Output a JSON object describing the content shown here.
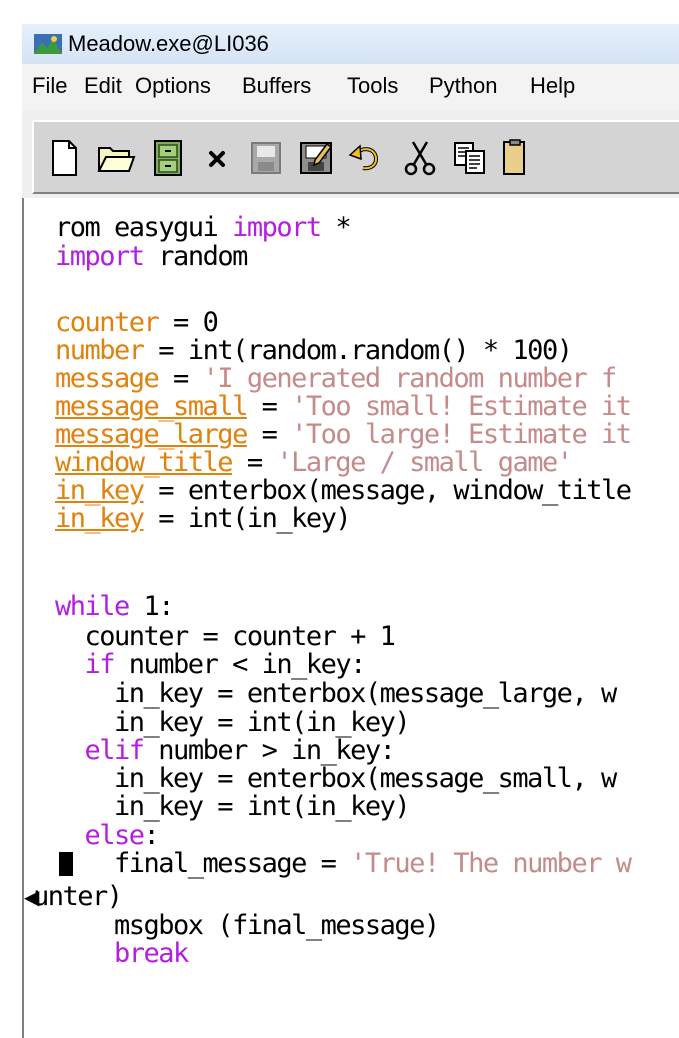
{
  "window": {
    "title": "Meadow.exe@LI036"
  },
  "menu": [
    "File",
    "Edit",
    "Options",
    "Buffers",
    "Tools",
    "Python",
    "Help"
  ],
  "toolbar": {
    "buttons": [
      "new-file",
      "open-folder",
      "dired",
      "close-buffer",
      "save",
      "save-as",
      "undo",
      "cut",
      "copy",
      "paste"
    ]
  },
  "editor": {
    "lines": [
      [
        {
          "t": "rom easygui ",
          "c": ""
        },
        {
          "t": "import",
          "c": "kw"
        },
        {
          "t": " *",
          "c": ""
        }
      ],
      [
        {
          "t": "import",
          "c": "kw"
        },
        {
          "t": " random",
          "c": ""
        }
      ],
      [],
      [
        {
          "t": "counter",
          "c": "var"
        },
        {
          "t": " = 0",
          "c": ""
        }
      ],
      [
        {
          "t": "number",
          "c": "var"
        },
        {
          "t": " = int(random.random() * 100)",
          "c": ""
        }
      ],
      [
        {
          "t": "message",
          "c": "var"
        },
        {
          "t": " = ",
          "c": ""
        },
        {
          "t": "'I generated random number f",
          "c": "str"
        }
      ],
      [
        {
          "t": "message_small",
          "c": "var ul"
        },
        {
          "t": " = ",
          "c": ""
        },
        {
          "t": "'Too small! Estimate it",
          "c": "str"
        }
      ],
      [
        {
          "t": "message_large",
          "c": "var ul"
        },
        {
          "t": " = ",
          "c": ""
        },
        {
          "t": "'Too large! Estimate it",
          "c": "str"
        }
      ],
      [
        {
          "t": "window_title",
          "c": "var ul"
        },
        {
          "t": " = ",
          "c": ""
        },
        {
          "t": "'Large / small game'",
          "c": "str"
        }
      ],
      [
        {
          "t": "in_key",
          "c": "var ul"
        },
        {
          "t": " = enterbox(message, window_title",
          "c": ""
        }
      ],
      [
        {
          "t": "in_key",
          "c": "var ul"
        },
        {
          "t": " = int(in_key)",
          "c": ""
        }
      ],
      [],
      [
        {
          "t": "while",
          "c": "kw"
        },
        {
          "t": " 1:",
          "c": ""
        }
      ],
      [
        {
          "t": "  counter = counter + 1",
          "c": ""
        }
      ],
      [
        {
          "t": "  ",
          "c": ""
        },
        {
          "t": "if",
          "c": "kw"
        },
        {
          "t": " number < in_key:",
          "c": ""
        }
      ],
      [
        {
          "t": "    in_key = enterbox(message_large, w",
          "c": ""
        }
      ],
      [
        {
          "t": "    in_key = int(in_key)",
          "c": ""
        }
      ],
      [
        {
          "t": "  ",
          "c": ""
        },
        {
          "t": "elif",
          "c": "kw"
        },
        {
          "t": " number > in_key:",
          "c": ""
        }
      ],
      [
        {
          "t": "    in_key = enterbox(message_small, w",
          "c": ""
        }
      ],
      [
        {
          "t": "    in_key = int(in_key)",
          "c": ""
        }
      ],
      [
        {
          "t": "  ",
          "c": ""
        },
        {
          "t": "else",
          "c": "kw"
        },
        {
          "t": ":",
          "c": ""
        }
      ],
      [
        {
          "t": "    final_message = ",
          "c": ""
        },
        {
          "t": "'True! The number w",
          "c": "str"
        }
      ],
      [
        {
          "t": "unter)",
          "c": ""
        }
      ],
      [
        {
          "t": "    msgbox (final_message)",
          "c": ""
        }
      ],
      [
        {
          "t": "    ",
          "c": ""
        },
        {
          "t": "break",
          "c": "kw"
        }
      ]
    ]
  }
}
